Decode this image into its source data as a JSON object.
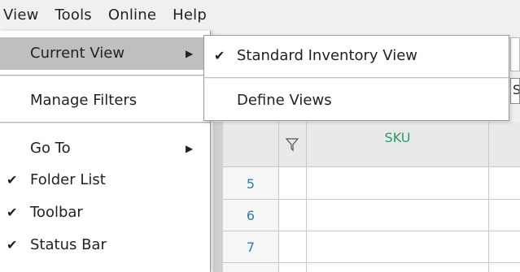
{
  "menubar": {
    "items": [
      "View",
      "Tools",
      "Online",
      "Help"
    ]
  },
  "view_menu": {
    "current_view": "Current View",
    "manage_filters": "Manage Filters",
    "go_to": "Go To",
    "folder_list": "Folder List",
    "toolbar": "Toolbar",
    "status_bar": "Status Bar",
    "check_glyph": "✔",
    "arrow_glyph": "▶"
  },
  "current_view_submenu": {
    "standard_inventory_view": "Standard Inventory View",
    "define_views": "Define Views",
    "check_glyph": "✔"
  },
  "grid": {
    "sku_header": "SKU",
    "row_numbers": [
      "5",
      "6",
      "7"
    ],
    "filter_icon": "filter-icon",
    "partial_field_text": "S"
  },
  "colors": {
    "sku_header": "#2c9a63",
    "row_number": "#2e7da8",
    "highlight": "#bfbfbf"
  }
}
